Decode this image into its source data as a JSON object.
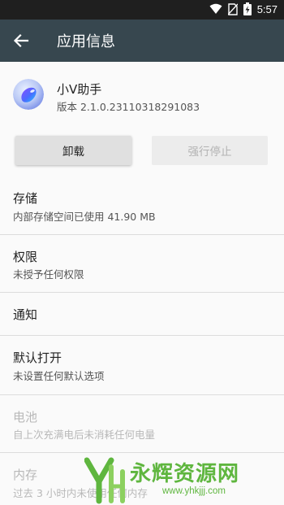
{
  "status_bar": {
    "time": "5:57",
    "icons": [
      "wifi-icon",
      "no-sim-icon",
      "battery-charging-icon"
    ]
  },
  "app_bar": {
    "title": "应用信息",
    "back_icon": "arrow-left-icon",
    "background": "#37474f"
  },
  "app": {
    "name": "小V助手",
    "version": "版本 2.1.0.23110318291083",
    "icon": "app-orb-icon"
  },
  "buttons": {
    "uninstall": "卸载",
    "force_stop": "强行停止",
    "force_stop_enabled": false
  },
  "sections": {
    "storage": {
      "title": "存储",
      "subtitle": "内部存储空间已使用 41.90 MB"
    },
    "permissions": {
      "title": "权限",
      "subtitle": "未授予任何权限"
    },
    "notifications": {
      "title": "通知"
    },
    "defaults": {
      "title": "默认打开",
      "subtitle": "未设置任何默认选项"
    },
    "battery": {
      "title": "电池",
      "subtitle": "自上次充满电后未消耗任何电量",
      "enabled": false
    },
    "memory": {
      "title": "内存",
      "subtitle": "过去 3 小时内未使用任何内存",
      "enabled": false
    }
  },
  "watermark": {
    "title": "永辉资源网",
    "url": "www.yhkjjj.com",
    "color": "#5fb63f"
  }
}
